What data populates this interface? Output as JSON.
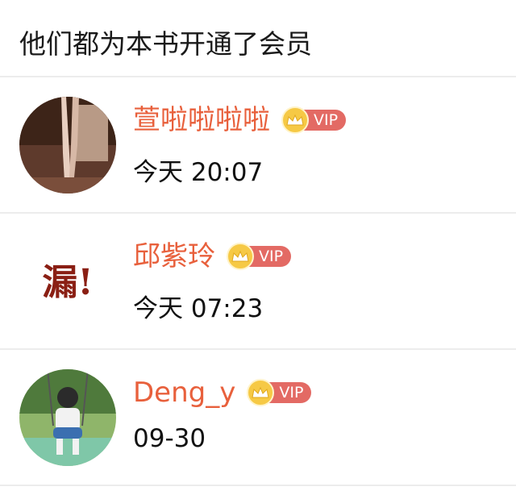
{
  "header": {
    "title": "他们都为本书开通了会员"
  },
  "members": [
    {
      "name": "萱啦啦啦啦",
      "badge": "VIP",
      "time": "今天 20:07",
      "avatar_icon": "photo-avatar"
    },
    {
      "name": "邱紫玲",
      "badge": "VIP",
      "time": "今天 07:23",
      "avatar_icon": "calligraphy-avatar",
      "avatar_text": "漏!"
    },
    {
      "name": "Deng_y",
      "badge": "VIP",
      "time": "09-30",
      "avatar_icon": "photo-avatar"
    }
  ],
  "colors": {
    "name": "#e8603c",
    "vip_tag": "#e36a64",
    "crown": "#f6c945",
    "divider": "#ececec"
  }
}
